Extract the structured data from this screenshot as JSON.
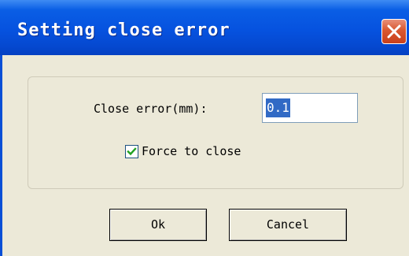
{
  "window": {
    "title": "Setting close error"
  },
  "form": {
    "close_error_label": "Close error(mm):",
    "close_error_value": "0.1",
    "force_close_label": "Force to close",
    "force_close_checked": true
  },
  "buttons": {
    "ok_label": "Ok",
    "cancel_label": "Cancel"
  },
  "icons": {
    "close": "close-icon",
    "check": "checkmark-icon"
  },
  "colors": {
    "titlebar": "#0652df",
    "close_button": "#d9572f",
    "dialog_face": "#ece9d8",
    "selection": "#316ac5",
    "checkmark": "#21a121"
  }
}
